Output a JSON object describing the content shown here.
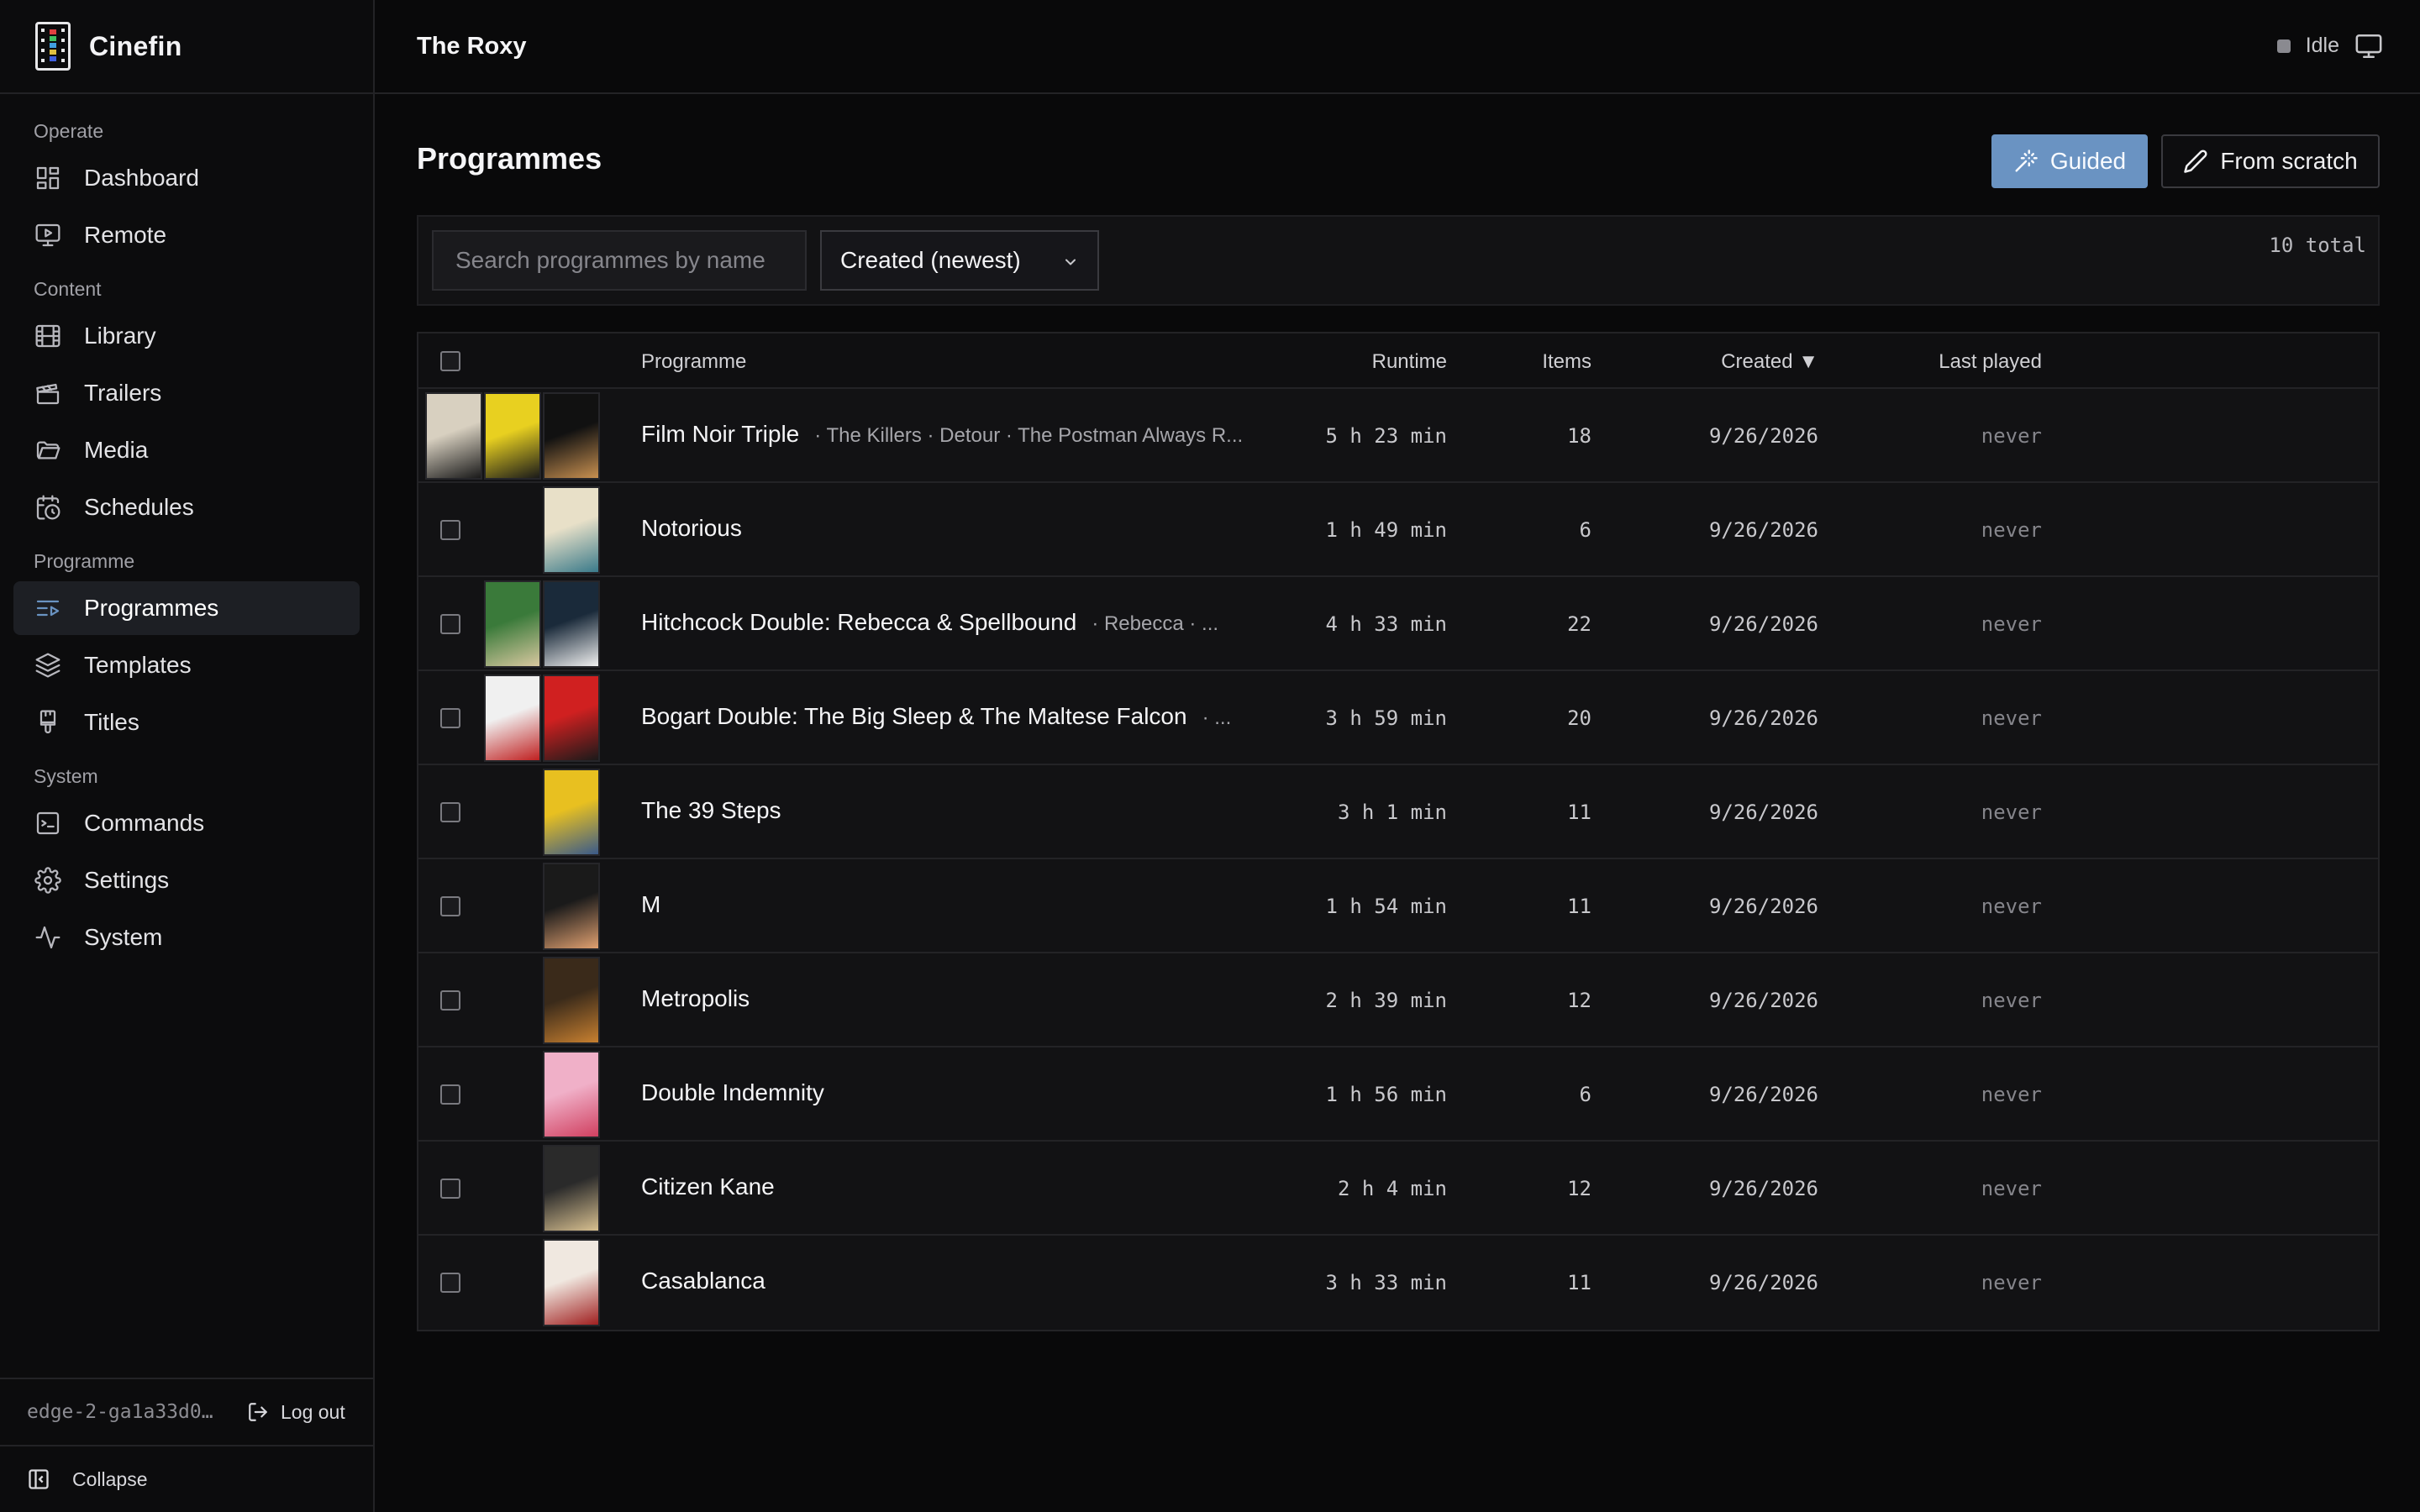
{
  "app": {
    "name": "Cinefin"
  },
  "sidebar": {
    "groups": [
      {
        "label": "Operate",
        "items": [
          {
            "label": "Dashboard",
            "icon": "dashboard-icon"
          },
          {
            "label": "Remote",
            "icon": "remote-icon"
          }
        ]
      },
      {
        "label": "Content",
        "items": [
          {
            "label": "Library",
            "icon": "film-icon"
          },
          {
            "label": "Trailers",
            "icon": "clapperboard-icon"
          },
          {
            "label": "Media",
            "icon": "folder-icon"
          },
          {
            "label": "Schedules",
            "icon": "calendar-clock-icon"
          }
        ]
      },
      {
        "label": "Programme",
        "items": [
          {
            "label": "Programmes",
            "icon": "list-play-icon",
            "active": true
          },
          {
            "label": "Templates",
            "icon": "layers-icon"
          },
          {
            "label": "Titles",
            "icon": "brush-icon"
          }
        ]
      },
      {
        "label": "System",
        "items": [
          {
            "label": "Commands",
            "icon": "terminal-icon"
          },
          {
            "label": "Settings",
            "icon": "gear-icon"
          },
          {
            "label": "System",
            "icon": "activity-icon"
          }
        ]
      }
    ],
    "host": "edge-2-ga1a33d0…",
    "logout_label": "Log out",
    "collapse_label": "Collapse"
  },
  "topbar": {
    "venue": "The Roxy",
    "status": "Idle"
  },
  "page": {
    "title": "Programmes",
    "guided_label": "Guided",
    "scratch_label": "From scratch"
  },
  "toolbar": {
    "search_placeholder": "Search programmes by name",
    "sort_value": "Created (newest)",
    "total": "10 total"
  },
  "table": {
    "headers": {
      "programme": "Programme",
      "runtime": "Runtime",
      "items": "Items",
      "created": "Created ▼",
      "last_played": "Last played"
    },
    "rows": [
      {
        "title": "Film Noir Triple",
        "sub": "· The Killers · Detour · The Postman Always R...",
        "runtime": "5 h 23 min",
        "items": "18",
        "created": "9/26/2026",
        "last_played": "never",
        "thumbs": [
          [
            "#d8d0c0",
            "#1a1a1a"
          ],
          [
            "#e8d020",
            "#1a1a1a"
          ],
          [
            "#111111",
            "#c89050"
          ]
        ]
      },
      {
        "title": "Notorious",
        "sub": "",
        "runtime": "1 h 49 min",
        "items": "6",
        "created": "9/26/2026",
        "last_played": "never",
        "thumbs": [
          [
            "#e8e0c8",
            "#3a7a8a"
          ]
        ]
      },
      {
        "title": "Hitchcock Double: Rebecca & Spellbound",
        "sub": "· Rebecca · ...",
        "runtime": "4 h 33 min",
        "items": "22",
        "created": "9/26/2026",
        "last_played": "never",
        "thumbs": [
          [
            "#3a7a3a",
            "#d8c8a0"
          ],
          [
            "#1a2a3a",
            "#f0f0f0"
          ]
        ]
      },
      {
        "title": "Bogart Double: The Big Sleep & The Maltese Falcon",
        "sub": "· ...",
        "runtime": "3 h 59 min",
        "items": "20",
        "created": "9/26/2026",
        "last_played": "never",
        "thumbs": [
          [
            "#f0f0f0",
            "#c02020"
          ],
          [
            "#d02020",
            "#1a1a1a"
          ]
        ]
      },
      {
        "title": "The 39 Steps",
        "sub": "",
        "runtime": "3 h 1 min",
        "items": "11",
        "created": "9/26/2026",
        "last_played": "never",
        "thumbs": [
          [
            "#e8c020",
            "#3a5a8a"
          ]
        ]
      },
      {
        "title": "M",
        "sub": "",
        "runtime": "1 h 54 min",
        "items": "11",
        "created": "9/26/2026",
        "last_played": "never",
        "thumbs": [
          [
            "#1a1a1a",
            "#e0a070"
          ]
        ]
      },
      {
        "title": "Metropolis",
        "sub": "",
        "runtime": "2 h 39 min",
        "items": "12",
        "created": "9/26/2026",
        "last_played": "never",
        "thumbs": [
          [
            "#3a2a1a",
            "#c88030"
          ]
        ]
      },
      {
        "title": "Double Indemnity",
        "sub": "",
        "runtime": "1 h 56 min",
        "items": "6",
        "created": "9/26/2026",
        "last_played": "never",
        "thumbs": [
          [
            "#f0b0c8",
            "#d04060"
          ]
        ]
      },
      {
        "title": "Citizen Kane",
        "sub": "",
        "runtime": "2 h 4 min",
        "items": "12",
        "created": "9/26/2026",
        "last_played": "never",
        "thumbs": [
          [
            "#2a2a2a",
            "#d8c090"
          ]
        ]
      },
      {
        "title": "Casablanca",
        "sub": "",
        "runtime": "3 h 33 min",
        "items": "11",
        "created": "9/26/2026",
        "last_played": "never",
        "thumbs": [
          [
            "#f0e8e0",
            "#a02020"
          ]
        ]
      }
    ]
  },
  "colors": {
    "accent": "#6a93c2",
    "background": "#09090a",
    "active_nav": "#1d1f24"
  }
}
